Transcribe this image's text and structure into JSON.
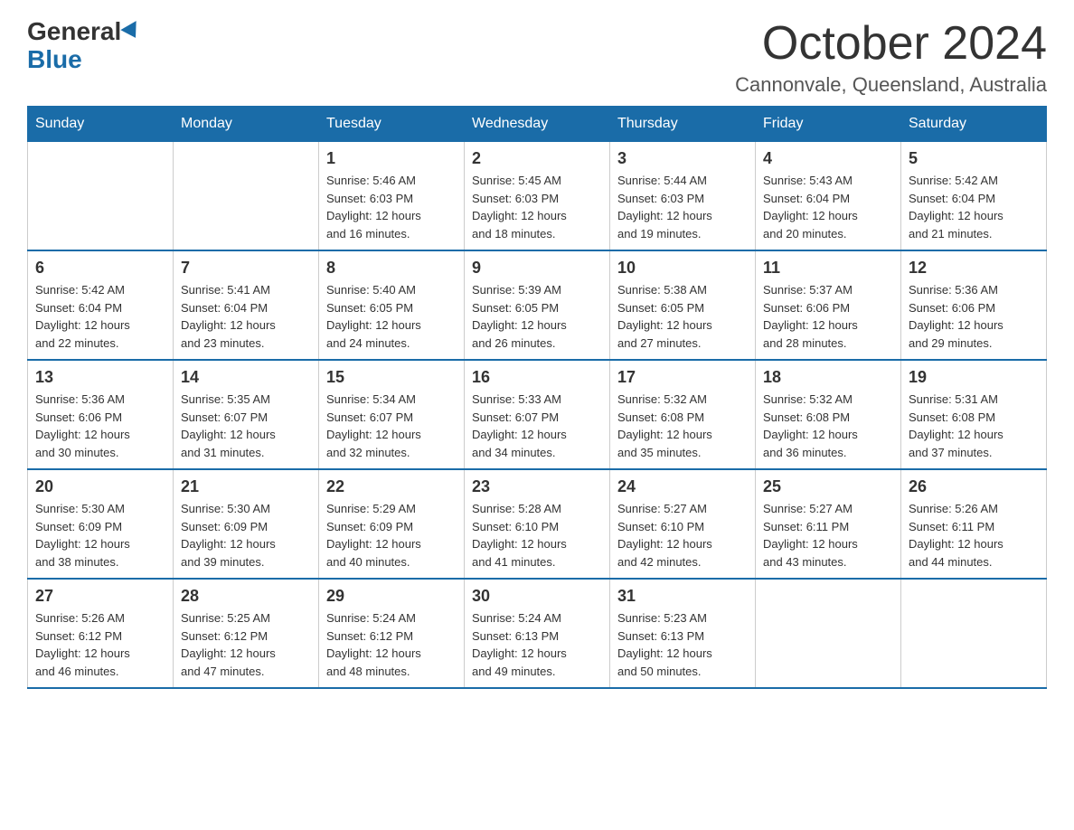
{
  "logo": {
    "general": "General",
    "blue": "Blue"
  },
  "title": "October 2024",
  "location": "Cannonvale, Queensland, Australia",
  "days_header": [
    "Sunday",
    "Monday",
    "Tuesday",
    "Wednesday",
    "Thursday",
    "Friday",
    "Saturday"
  ],
  "weeks": [
    [
      {
        "day": "",
        "info": ""
      },
      {
        "day": "",
        "info": ""
      },
      {
        "day": "1",
        "info": "Sunrise: 5:46 AM\nSunset: 6:03 PM\nDaylight: 12 hours\nand 16 minutes."
      },
      {
        "day": "2",
        "info": "Sunrise: 5:45 AM\nSunset: 6:03 PM\nDaylight: 12 hours\nand 18 minutes."
      },
      {
        "day": "3",
        "info": "Sunrise: 5:44 AM\nSunset: 6:03 PM\nDaylight: 12 hours\nand 19 minutes."
      },
      {
        "day": "4",
        "info": "Sunrise: 5:43 AM\nSunset: 6:04 PM\nDaylight: 12 hours\nand 20 minutes."
      },
      {
        "day": "5",
        "info": "Sunrise: 5:42 AM\nSunset: 6:04 PM\nDaylight: 12 hours\nand 21 minutes."
      }
    ],
    [
      {
        "day": "6",
        "info": "Sunrise: 5:42 AM\nSunset: 6:04 PM\nDaylight: 12 hours\nand 22 minutes."
      },
      {
        "day": "7",
        "info": "Sunrise: 5:41 AM\nSunset: 6:04 PM\nDaylight: 12 hours\nand 23 minutes."
      },
      {
        "day": "8",
        "info": "Sunrise: 5:40 AM\nSunset: 6:05 PM\nDaylight: 12 hours\nand 24 minutes."
      },
      {
        "day": "9",
        "info": "Sunrise: 5:39 AM\nSunset: 6:05 PM\nDaylight: 12 hours\nand 26 minutes."
      },
      {
        "day": "10",
        "info": "Sunrise: 5:38 AM\nSunset: 6:05 PM\nDaylight: 12 hours\nand 27 minutes."
      },
      {
        "day": "11",
        "info": "Sunrise: 5:37 AM\nSunset: 6:06 PM\nDaylight: 12 hours\nand 28 minutes."
      },
      {
        "day": "12",
        "info": "Sunrise: 5:36 AM\nSunset: 6:06 PM\nDaylight: 12 hours\nand 29 minutes."
      }
    ],
    [
      {
        "day": "13",
        "info": "Sunrise: 5:36 AM\nSunset: 6:06 PM\nDaylight: 12 hours\nand 30 minutes."
      },
      {
        "day": "14",
        "info": "Sunrise: 5:35 AM\nSunset: 6:07 PM\nDaylight: 12 hours\nand 31 minutes."
      },
      {
        "day": "15",
        "info": "Sunrise: 5:34 AM\nSunset: 6:07 PM\nDaylight: 12 hours\nand 32 minutes."
      },
      {
        "day": "16",
        "info": "Sunrise: 5:33 AM\nSunset: 6:07 PM\nDaylight: 12 hours\nand 34 minutes."
      },
      {
        "day": "17",
        "info": "Sunrise: 5:32 AM\nSunset: 6:08 PM\nDaylight: 12 hours\nand 35 minutes."
      },
      {
        "day": "18",
        "info": "Sunrise: 5:32 AM\nSunset: 6:08 PM\nDaylight: 12 hours\nand 36 minutes."
      },
      {
        "day": "19",
        "info": "Sunrise: 5:31 AM\nSunset: 6:08 PM\nDaylight: 12 hours\nand 37 minutes."
      }
    ],
    [
      {
        "day": "20",
        "info": "Sunrise: 5:30 AM\nSunset: 6:09 PM\nDaylight: 12 hours\nand 38 minutes."
      },
      {
        "day": "21",
        "info": "Sunrise: 5:30 AM\nSunset: 6:09 PM\nDaylight: 12 hours\nand 39 minutes."
      },
      {
        "day": "22",
        "info": "Sunrise: 5:29 AM\nSunset: 6:09 PM\nDaylight: 12 hours\nand 40 minutes."
      },
      {
        "day": "23",
        "info": "Sunrise: 5:28 AM\nSunset: 6:10 PM\nDaylight: 12 hours\nand 41 minutes."
      },
      {
        "day": "24",
        "info": "Sunrise: 5:27 AM\nSunset: 6:10 PM\nDaylight: 12 hours\nand 42 minutes."
      },
      {
        "day": "25",
        "info": "Sunrise: 5:27 AM\nSunset: 6:11 PM\nDaylight: 12 hours\nand 43 minutes."
      },
      {
        "day": "26",
        "info": "Sunrise: 5:26 AM\nSunset: 6:11 PM\nDaylight: 12 hours\nand 44 minutes."
      }
    ],
    [
      {
        "day": "27",
        "info": "Sunrise: 5:26 AM\nSunset: 6:12 PM\nDaylight: 12 hours\nand 46 minutes."
      },
      {
        "day": "28",
        "info": "Sunrise: 5:25 AM\nSunset: 6:12 PM\nDaylight: 12 hours\nand 47 minutes."
      },
      {
        "day": "29",
        "info": "Sunrise: 5:24 AM\nSunset: 6:12 PM\nDaylight: 12 hours\nand 48 minutes."
      },
      {
        "day": "30",
        "info": "Sunrise: 5:24 AM\nSunset: 6:13 PM\nDaylight: 12 hours\nand 49 minutes."
      },
      {
        "day": "31",
        "info": "Sunrise: 5:23 AM\nSunset: 6:13 PM\nDaylight: 12 hours\nand 50 minutes."
      },
      {
        "day": "",
        "info": ""
      },
      {
        "day": "",
        "info": ""
      }
    ]
  ]
}
